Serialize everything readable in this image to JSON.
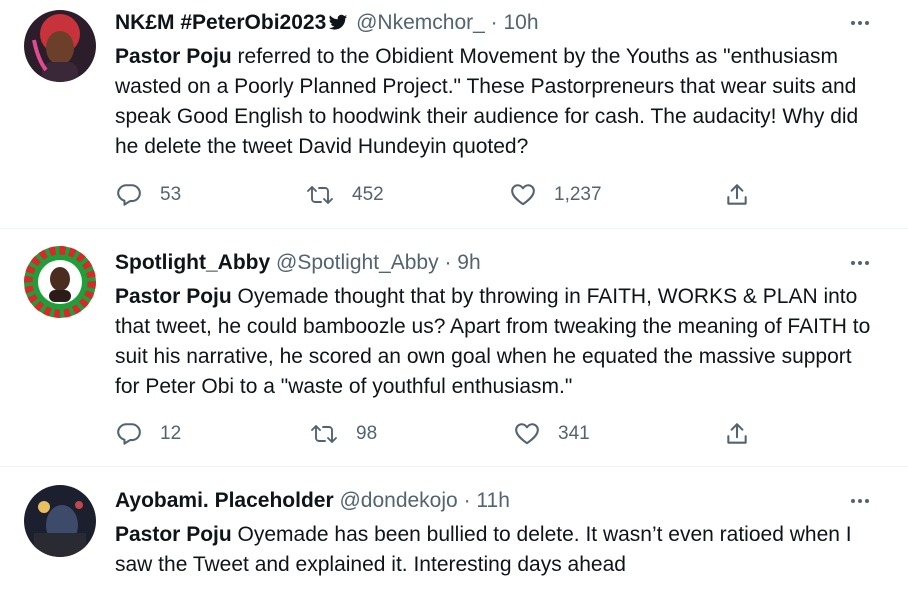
{
  "tweets": [
    {
      "display_name": "NK£M #PeterObi2023",
      "handle": "@Nkemchor_",
      "separator": "·",
      "time": "10h",
      "mention": "Pastor Poju",
      "text": " referred to the Obidient Movement by the Youths as \"enthusiasm wasted on a Poorly Planned Project.\" These Pastorpreneurs that wear suits and speak Good English to hoodwink their audience for cash. The audacity! Why did he delete the tweet David Hundeyin quoted?",
      "replies": "53",
      "retweets": "452",
      "likes": "1,237",
      "avatar_color": "#d63a3a"
    },
    {
      "display_name": "Spotlight_Abby",
      "handle": "@Spotlight_Abby",
      "separator": "·",
      "time": "9h",
      "mention": "Pastor Poju",
      "text": " Oyemade thought that by throwing in FAITH, WORKS & PLAN into that tweet, he could bamboozle us? Apart from tweaking the meaning of FAITH to suit his narrative, he scored an own goal when he equated the massive support for Peter Obi to a \"waste of youthful enthusiasm.\"",
      "replies": "12",
      "retweets": "98",
      "likes": "341",
      "avatar_color": "#1f9e3a"
    },
    {
      "display_name": "Ayobami. Placeholder",
      "handle": "@dondekojo",
      "separator": "·",
      "time": "11h",
      "mention": "Pastor Poju",
      "text": " Oyemade has been bullied to delete. It wasn’t even ratioed when I saw the Tweet and explained it. Interesting days ahead",
      "avatar_color": "#2a3a5a"
    }
  ],
  "icons": {
    "reply": "reply-icon",
    "retweet": "retweet-icon",
    "like": "heart-icon",
    "share": "share-icon",
    "more": "more-icon",
    "verified_bird": "twitter-bird-icon"
  },
  "colors": {
    "text": "#0f1419",
    "muted": "#536471",
    "divider": "#eff3f4"
  }
}
